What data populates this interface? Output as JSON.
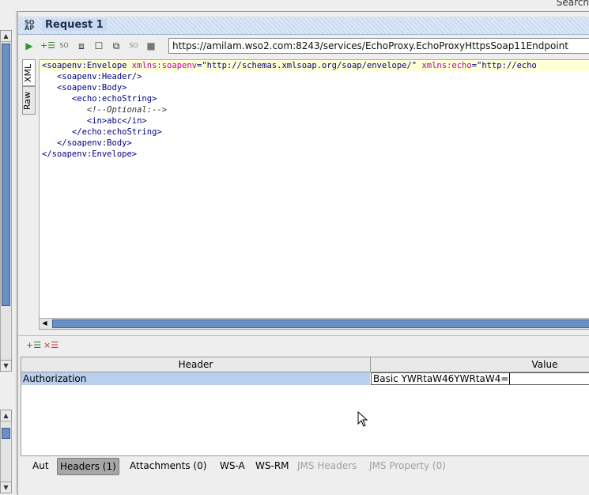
{
  "top": {
    "search_label": "Search"
  },
  "request": {
    "title": "Request 1"
  },
  "toolbar": {
    "url": "https://amilam.wso2.com:8243/services/EchoProxy.EchoProxyHttpsSoap11Endpoint"
  },
  "editor": {
    "side_tabs": [
      "XML",
      "Raw"
    ],
    "lines": [
      {
        "indent": "",
        "tag": "<soapenv:Envelope ",
        "attr1": "xmlns:soapenv",
        "eq1": "=\"http://schemas.xmlsoap.org/soap/envelope/\" ",
        "attr2": "xmlns:echo",
        "eq2": "=\"http://echo"
      },
      {
        "text": "   <soapenv:Header/>"
      },
      {
        "text": "   <soapenv:Body>"
      },
      {
        "text": "      <echo:echoString>"
      },
      {
        "comment": "         <!--Optional:-->"
      },
      {
        "text": "         <in>abc</in>"
      },
      {
        "text": "      </echo:echoString>"
      },
      {
        "text": "   </soapenv:Body>"
      },
      {
        "text": "</soapenv:Envelope>"
      }
    ]
  },
  "headers_table": {
    "columns": [
      "Header",
      "Value"
    ],
    "rows": [
      {
        "name": "Authorization",
        "value": "Basic YWRtaW46YWRtaW4="
      }
    ]
  },
  "bottom_tabs": [
    {
      "label": "Aut",
      "state": "normal"
    },
    {
      "label": "Headers (1)",
      "state": "active"
    },
    {
      "label": "Attachments (0)",
      "state": "normal"
    },
    {
      "label": "WS-A",
      "state": "normal"
    },
    {
      "label": "WS-RM",
      "state": "normal"
    },
    {
      "label": "JMS Headers",
      "state": "disabled"
    },
    {
      "label": "JMS Property (0)",
      "state": "disabled"
    }
  ],
  "colors": {
    "selection": "#b8cfee",
    "scroll_thumb": "#6a8fc2",
    "title_bar": "#c9daf0"
  }
}
